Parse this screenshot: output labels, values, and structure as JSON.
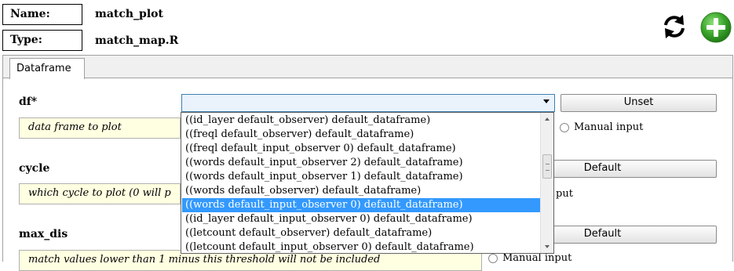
{
  "header": {
    "name_label": "Name:",
    "name_value": "match_plot",
    "type_label": "Type:",
    "type_value": "match_map.R",
    "refresh_icon": "refresh-icon",
    "add_icon": "add-icon",
    "add_color": "#3aa52b"
  },
  "tabs": [
    {
      "label": "Dataframe"
    }
  ],
  "params": {
    "df": {
      "name": "df*",
      "selected": "",
      "button": "Unset",
      "description": "data frame to plot",
      "radio_label": "Manual input"
    },
    "cycle": {
      "name": "cycle",
      "description": "which cycle to plot (0 will p",
      "button": "Default",
      "radio_label": "put"
    },
    "max_dis": {
      "name": "max_dis",
      "description": "match values lower than 1 minus this threshold will not be included",
      "button": "Default",
      "radio_label": "Manual input"
    }
  },
  "dropdown": {
    "options": [
      "((id_layer default_observer) default_dataframe)",
      "((freql default_observer) default_dataframe)",
      "((freql default_input_observer 0) default_dataframe)",
      "((words default_input_observer 2) default_dataframe)",
      "((words default_input_observer 1) default_dataframe)",
      "((words default_observer) default_dataframe)",
      "((words default_input_observer 0) default_dataframe)",
      "((id_layer default_input_observer 0) default_dataframe)",
      "((letcount default_observer) default_dataframe)",
      "((letcount default_input_observer 0) default_dataframe)"
    ],
    "selected_index": 6
  },
  "colors": {
    "description_bg": "#ffffe1",
    "selection_bg": "#3399ff",
    "combo_bg": "#eaf3fc",
    "combo_border": "#3c7fb1"
  }
}
